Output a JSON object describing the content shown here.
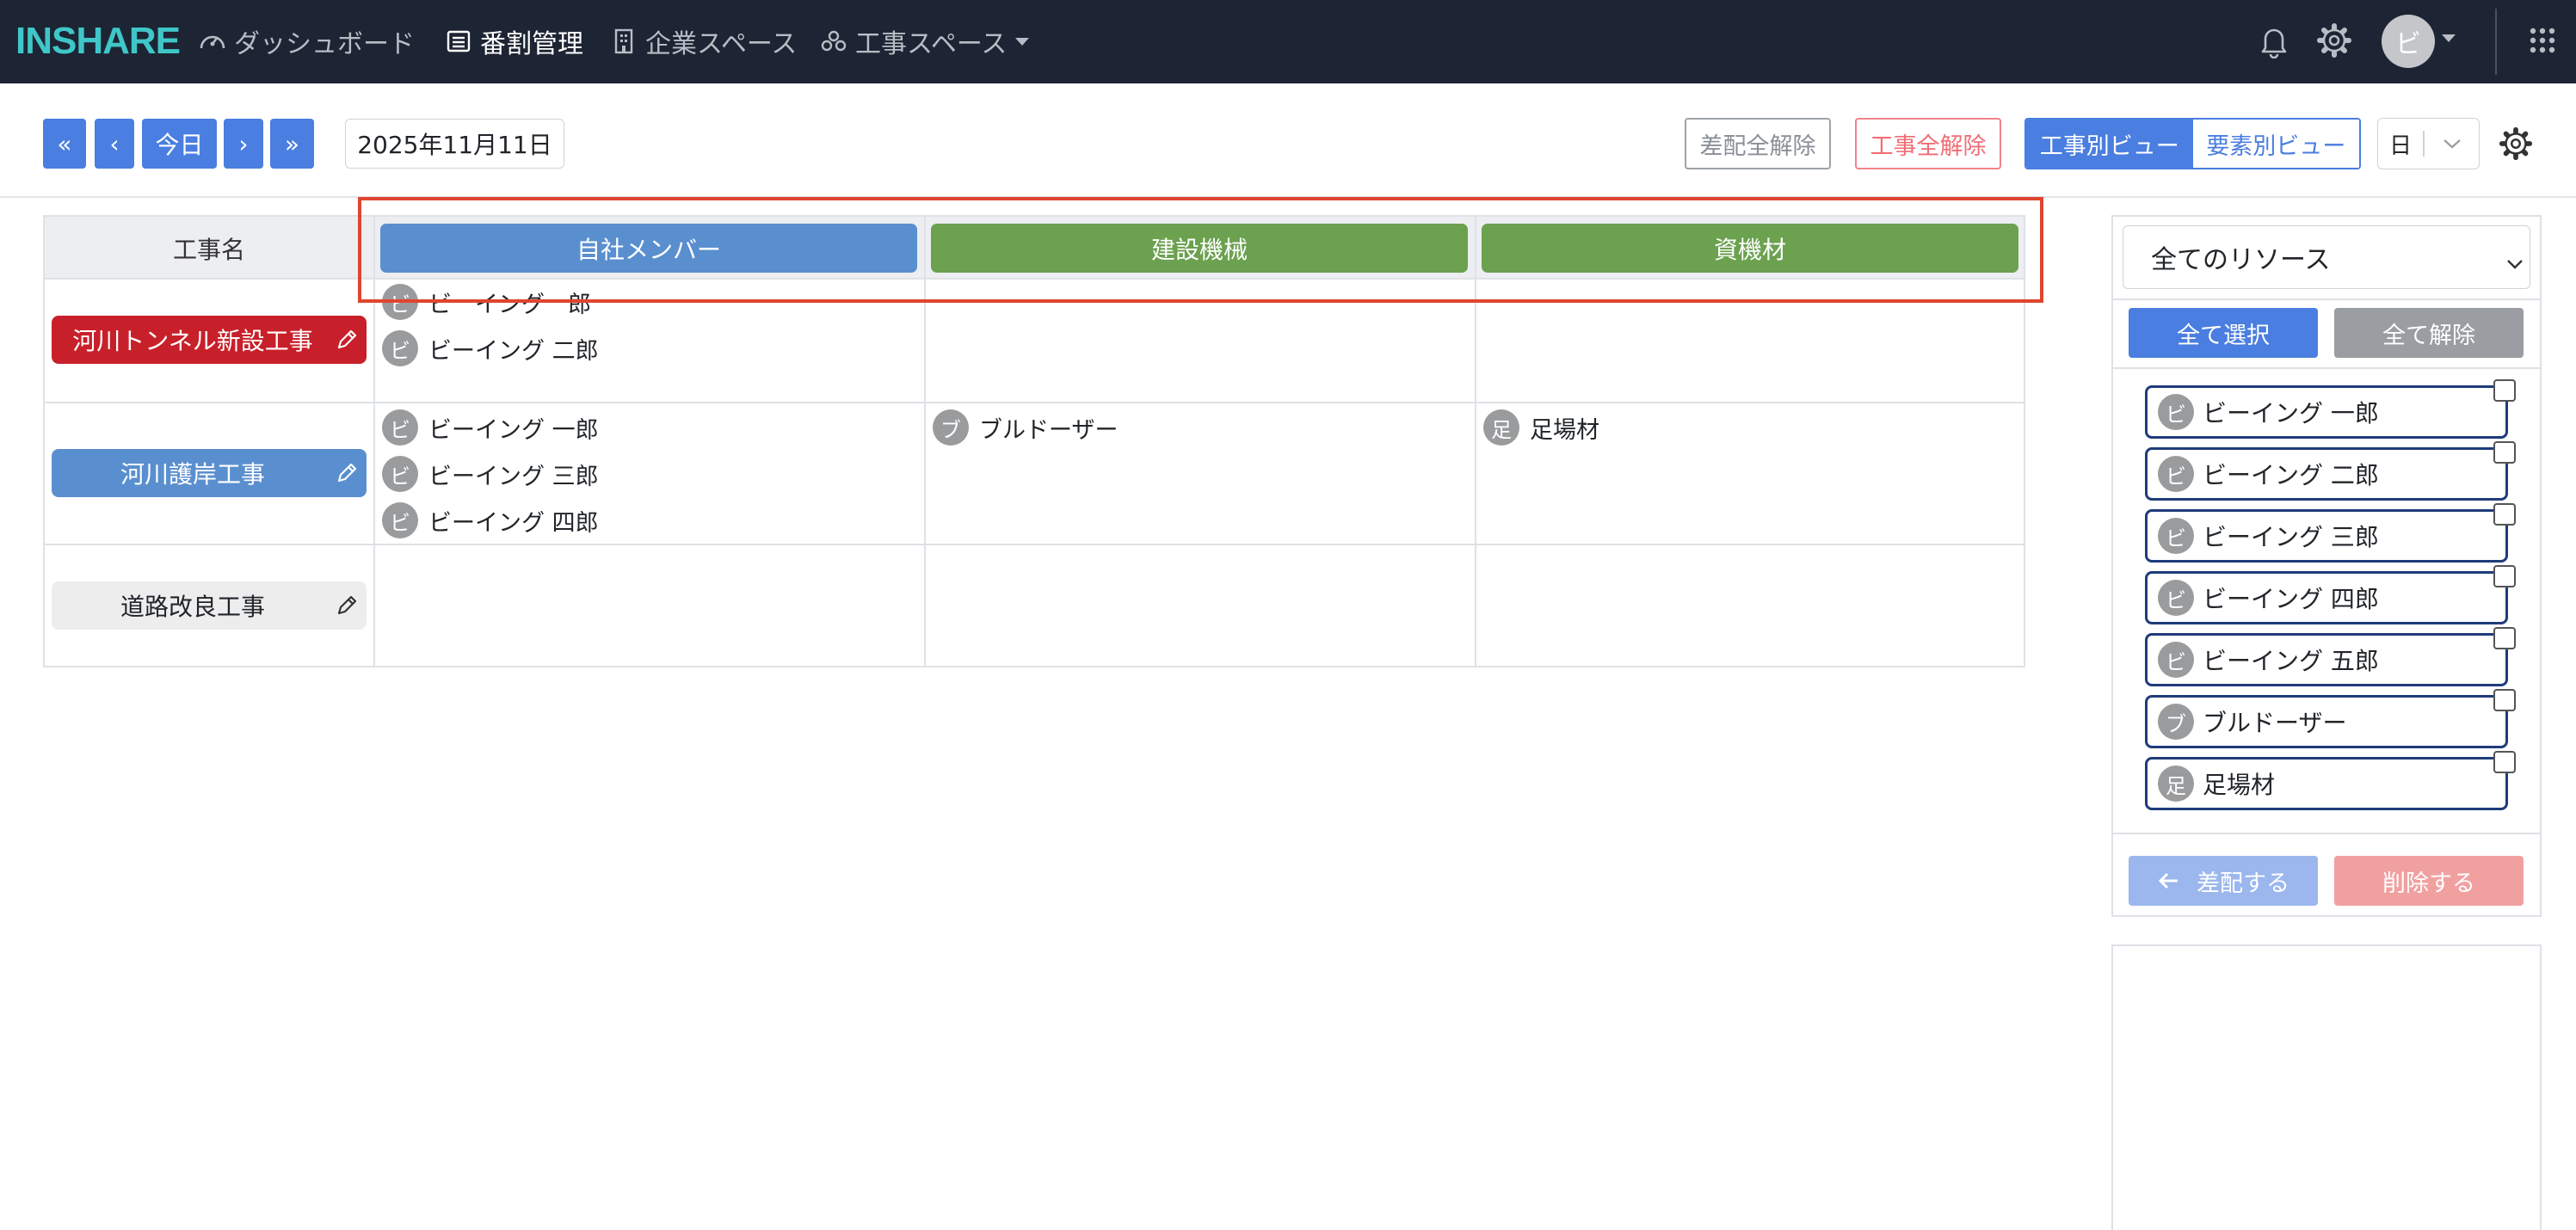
{
  "nav": {
    "logo": "INSHARE",
    "items": [
      {
        "label": "ダッシュボード",
        "icon": "gauge-icon"
      },
      {
        "label": "番割管理",
        "icon": "list-icon"
      },
      {
        "label": "企業スペース",
        "icon": "building-icon"
      },
      {
        "label": "工事スペース",
        "icon": "group-icon"
      }
    ],
    "avatar": "ビ"
  },
  "toolbar": {
    "first": "«",
    "prev": "‹",
    "today": "今日",
    "next": "›",
    "last": "»",
    "date": "2025年11月11日",
    "clear_assign": "差配全解除",
    "clear_projects": "工事全解除",
    "view_project": "工事別ビュー",
    "view_element": "要素別ビュー",
    "unit": "日"
  },
  "schedule": {
    "name_header": "工事名",
    "resource_headers": [
      {
        "label": "自社メンバー",
        "color": "#5a8fcf"
      },
      {
        "label": "建設機械",
        "color": "#6ba14f"
      },
      {
        "label": "資機材",
        "color": "#6ba14f"
      }
    ],
    "projects": [
      {
        "name": "河川トンネル新設工事",
        "members": [
          {
            "initial": "ビ",
            "name": "ビ　イング　郎"
          },
          {
            "initial": "ビ",
            "name": "ビーイング 二郎"
          }
        ],
        "machines": [],
        "materials": []
      },
      {
        "name": "河川護岸工事",
        "members": [
          {
            "initial": "ビ",
            "name": "ビーイング 一郎"
          },
          {
            "initial": "ビ",
            "name": "ビーイング 三郎"
          },
          {
            "initial": "ビ",
            "name": "ビーイング 四郎"
          }
        ],
        "machines": [
          {
            "initial": "ブ",
            "name": "ブルドーザー"
          }
        ],
        "materials": [
          {
            "initial": "足",
            "name": "足場材"
          }
        ]
      },
      {
        "name": "道路改良工事",
        "members": [],
        "machines": [],
        "materials": []
      }
    ]
  },
  "resources": {
    "filter": "全てのリソース",
    "select_all": "全て選択",
    "deselect_all": "全て解除",
    "items": [
      {
        "initial": "ビ",
        "name": "ビーイング 一郎"
      },
      {
        "initial": "ビ",
        "name": "ビーイング 二郎"
      },
      {
        "initial": "ビ",
        "name": "ビーイング 三郎"
      },
      {
        "initial": "ビ",
        "name": "ビーイング 四郎"
      },
      {
        "initial": "ビ",
        "name": "ビーイング 五郎"
      },
      {
        "initial": "ブ",
        "name": "ブルドーザー"
      },
      {
        "initial": "足",
        "name": "足場材"
      }
    ],
    "assign": "差配する",
    "delete": "削除する"
  },
  "colors": {
    "nav_bg": "#1d2433",
    "primary": "#4a7ee0",
    "project_red": "#c8202a",
    "project_blue": "#5a8fcf",
    "project_gray": "#ededee",
    "annotation": "#e0452f"
  }
}
